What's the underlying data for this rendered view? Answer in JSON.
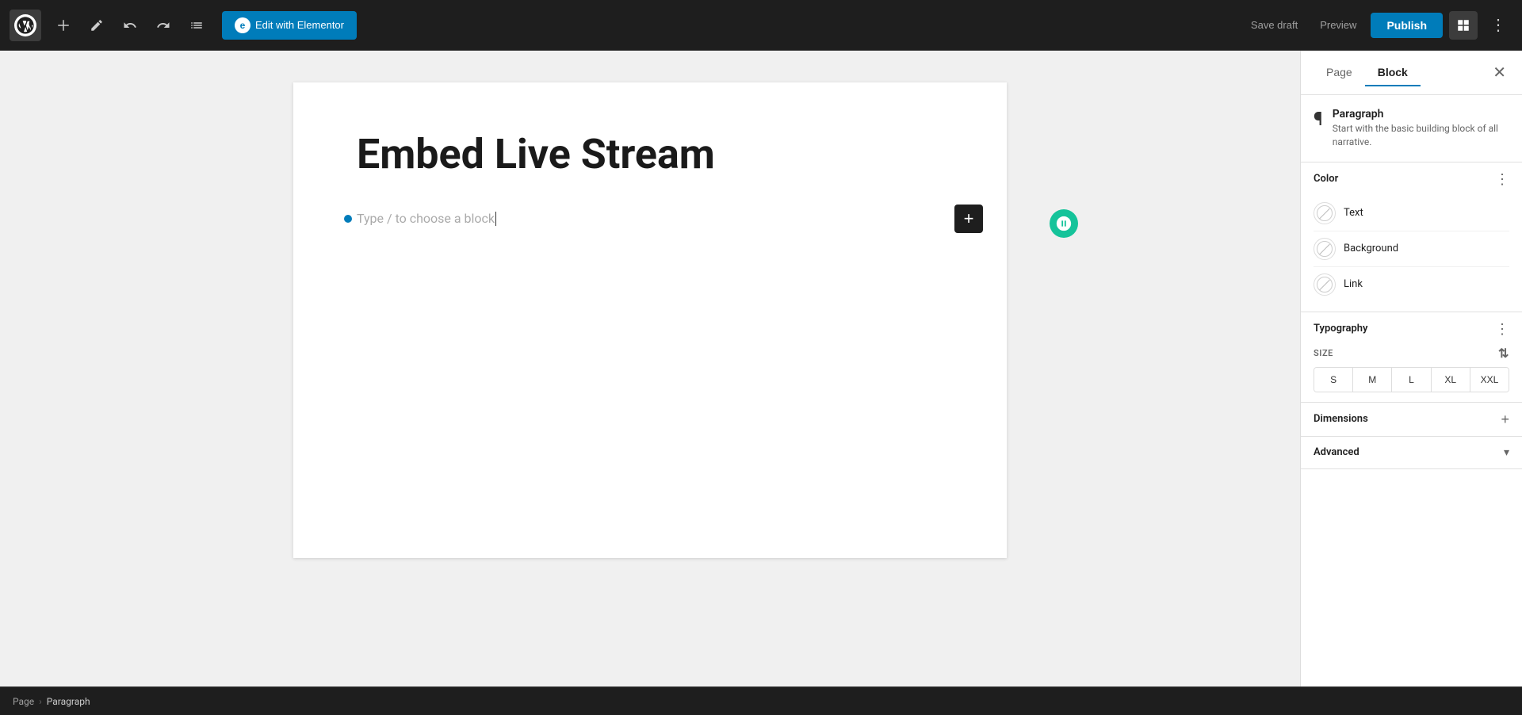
{
  "toolbar": {
    "edit_elementor_label": "Edit with Elementor",
    "save_draft_label": "Save draft",
    "preview_label": "Preview",
    "publish_label": "Publish"
  },
  "canvas": {
    "page_title": "Embed Live Stream",
    "block_placeholder": "Type / to choose a block"
  },
  "breadcrumb": {
    "page_label": "Page",
    "separator": "›",
    "current": "Paragraph"
  },
  "right_panel": {
    "tabs": [
      {
        "id": "page",
        "label": "Page"
      },
      {
        "id": "block",
        "label": "Block"
      }
    ],
    "active_tab": "Block",
    "block_info": {
      "title": "Paragraph",
      "description": "Start with the basic building block of all narrative."
    },
    "color_section": {
      "title": "Color",
      "items": [
        {
          "id": "text",
          "label": "Text"
        },
        {
          "id": "background",
          "label": "Background"
        },
        {
          "id": "link",
          "label": "Link"
        }
      ]
    },
    "typography_section": {
      "title": "Typography",
      "size_label": "SIZE",
      "sizes": [
        "S",
        "M",
        "L",
        "XL",
        "XXL"
      ]
    },
    "dimensions_section": {
      "title": "Dimensions"
    },
    "advanced_section": {
      "title": "Advanced"
    }
  }
}
